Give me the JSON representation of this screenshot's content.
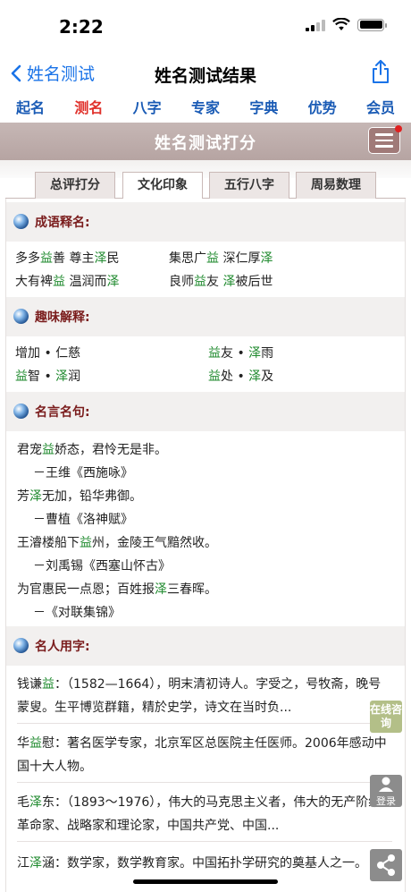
{
  "status": {
    "time": "2:22"
  },
  "nav": {
    "back_label": "姓名测试",
    "title": "姓名测试结果"
  },
  "top_tabs": [
    "起名",
    "测名",
    "八字",
    "专家",
    "字典",
    "优势",
    "会员"
  ],
  "banner": {
    "title": "姓名测试打分"
  },
  "inner_tabs": [
    "总评打分",
    "文化印象",
    "五行八字",
    "周易数理"
  ],
  "sections": {
    "idioms": {
      "title": "成语释名:",
      "rows": [
        [
          [
            [
              "多多",
              ""
            ],
            [
              "益",
              "g"
            ],
            [
              "善 尊主",
              ""
            ],
            [
              "泽",
              "g"
            ],
            [
              "民",
              ""
            ]
          ],
          [
            [
              "集思广",
              ""
            ],
            [
              "益",
              "g"
            ],
            [
              " 深仁厚",
              ""
            ],
            [
              "泽",
              "g"
            ]
          ]
        ],
        [
          [
            [
              "大有裨",
              ""
            ],
            [
              "益",
              "g"
            ],
            [
              " 温润而",
              ""
            ],
            [
              "泽",
              "g"
            ]
          ],
          [
            [
              "良师",
              ""
            ],
            [
              "益",
              "g"
            ],
            [
              "友 ",
              ""
            ],
            [
              "泽",
              "g"
            ],
            [
              "被后世",
              ""
            ]
          ]
        ]
      ]
    },
    "fun": {
      "title": "趣味解释:",
      "rows": [
        [
          [
            [
              "增加 • 仁慈",
              ""
            ]
          ],
          [
            [
              "益",
              "g"
            ],
            [
              "友 • ",
              ""
            ],
            [
              "泽",
              "g"
            ],
            [
              "雨",
              ""
            ]
          ]
        ],
        [
          [
            [
              "益",
              "g"
            ],
            [
              "智 • ",
              ""
            ],
            [
              "泽",
              "g"
            ],
            [
              "润",
              ""
            ]
          ],
          [
            [
              "益",
              "g"
            ],
            [
              "处 • ",
              ""
            ],
            [
              "泽",
              "g"
            ],
            [
              "及",
              ""
            ]
          ]
        ]
      ]
    },
    "quotes": {
      "title": "名言名句:",
      "lines": [
        [
          [
            "君宠",
            ""
          ],
          [
            "益",
            "g"
          ],
          [
            "娇态，君怜无是非。",
            ""
          ]
        ],
        [
          [
            "－王维《西施咏》",
            ""
          ]
        ],
        [
          [
            "芳",
            ""
          ],
          [
            "泽",
            "g"
          ],
          [
            "无加，铅华弗御。",
            ""
          ]
        ],
        [
          [
            "－曹植《洛神赋》",
            ""
          ]
        ],
        [
          [
            "王濬楼船下",
            ""
          ],
          [
            "益",
            "g"
          ],
          [
            "州，金陵王气黯然收。",
            ""
          ]
        ],
        [
          [
            "－刘禹锡《西塞山怀古》",
            ""
          ]
        ],
        [
          [
            "为官惠民一点恩；百姓报",
            ""
          ],
          [
            "泽",
            "g"
          ],
          [
            "三春晖。",
            ""
          ]
        ],
        [
          [
            "－《对联集锦》",
            ""
          ]
        ]
      ]
    },
    "famous": {
      "title": "名人用字:",
      "items": [
        [
          [
            "钱谦",
            ""
          ],
          [
            "益",
            "g"
          ],
          [
            "：（1582—1664），明末清初诗人。字受之，号牧斋，晚号蒙叟。生平博览群籍，精於史学，诗文在当时负...",
            ""
          ]
        ],
        [
          [
            "华",
            ""
          ],
          [
            "益",
            "g"
          ],
          [
            "慰：著名医学专家，北京军区总医院主任医师。2006年感动中国十大人物。",
            ""
          ]
        ],
        [
          [
            "毛",
            ""
          ],
          [
            "泽",
            "g"
          ],
          [
            "东：（1893～1976），伟大的马克思主义者，伟大的无产阶级革命家、战略家和理论家，中国共产党、中国...",
            ""
          ]
        ],
        [
          [
            "江",
            ""
          ],
          [
            "泽",
            "g"
          ],
          [
            "涵：数学家，数学教育家。中国拓扑学研究的奠基人之一。",
            ""
          ]
        ]
      ]
    }
  },
  "floating": {
    "consult": "在线咨询",
    "login": "登录"
  }
}
